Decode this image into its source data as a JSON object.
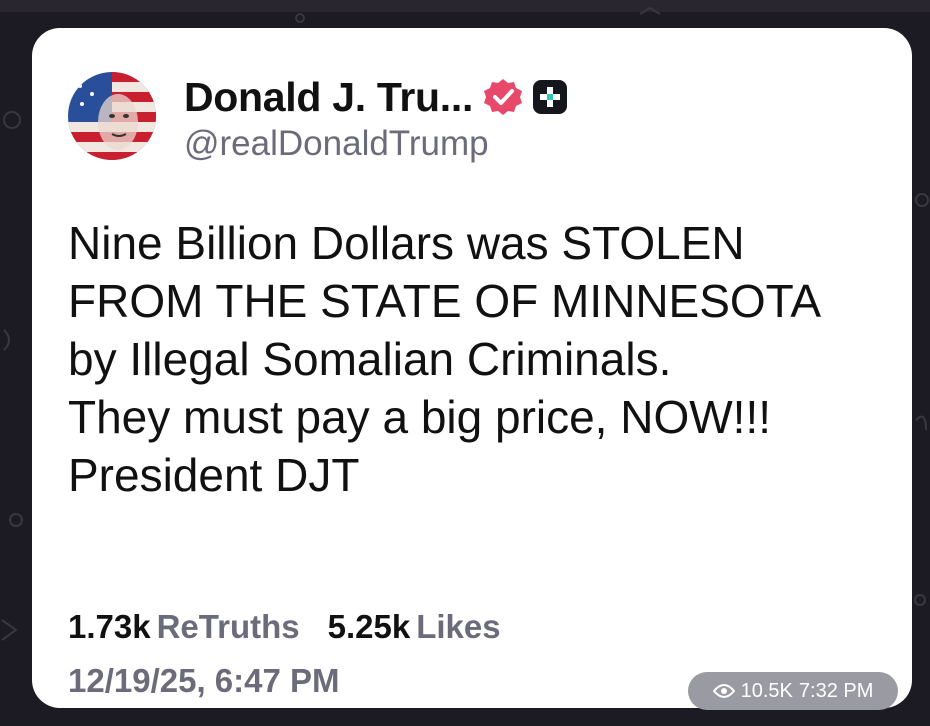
{
  "post": {
    "display_name": "Donald J. Tru...",
    "handle": "@realDonaldTrump",
    "avatar_icon": "flag-portrait-avatar",
    "verified_icon": "verified-badge-icon",
    "verified_color": "#e8496a",
    "plus_icon": "plus-badge-icon",
    "body_lines": [
      "Nine Billion Dollars was STOLEN",
      "FROM THE STATE OF MINNESOTA",
      "by Illegal Somalian Criminals.",
      "They must pay a big price, NOW!!!",
      "President DJT"
    ],
    "retruths_count": "1.73k",
    "retruths_label": "ReTruths",
    "likes_count": "5.25k",
    "likes_label": "Likes",
    "timestamp": "12/19/25, 6:47 PM"
  },
  "overlay": {
    "views": "10.5K",
    "time": "7:32 PM",
    "eye_icon": "eye-icon"
  }
}
